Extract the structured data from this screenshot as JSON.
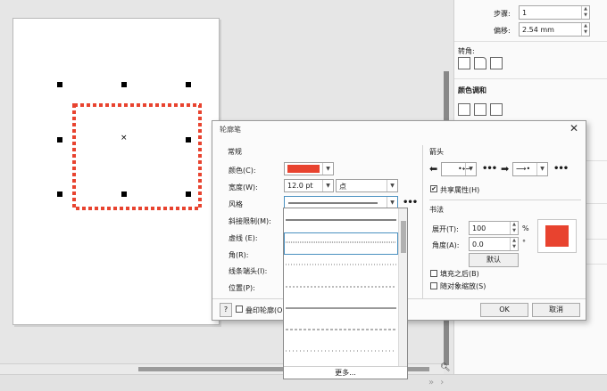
{
  "docker": {
    "step_label": "步骤:",
    "step_value": "1",
    "offset_label": "偏移:",
    "offset_value": "2.54 mm",
    "corner_heading": "转角:",
    "color_blend_heading": "颜色调和"
  },
  "dialog": {
    "title": "轮廓笔",
    "close_glyph": "✕",
    "general_heading": "常规",
    "color_label": "颜色(C):",
    "color_value": "#e8432f",
    "width_label": "宽度(W):",
    "width_value": "12.0 pt",
    "unit_value": "点",
    "style_label": "风格",
    "miter_label": "斜接限制(M):",
    "dash_label": "虚线 (E):",
    "corner_label": "角(R):",
    "linecap_label": "线条端头(I):",
    "position_label": "位置(P):",
    "arrows_heading": "箭头",
    "share_attr_label": "共享属性(H)",
    "calligraphy_heading": "书法",
    "stretch_label": "展开(T):",
    "stretch_value": "100",
    "stretch_unit": "%",
    "angle_label": "角度(A):",
    "angle_value": "0.0",
    "angle_unit": "°",
    "default_button": "默认",
    "fill_behind_label": "填充之后(B)",
    "scale_with_object_label": "随对象缩放(S)",
    "help_button": "?",
    "overprint_label": "叠印轮廓(O)",
    "ok_button": "OK",
    "cancel_button": "取消",
    "more_dots": "•••"
  },
  "style_list": {
    "more_label": "更多..."
  },
  "colors": {
    "accent_red": "#e8432f",
    "selection_blue": "#4a90c0"
  }
}
